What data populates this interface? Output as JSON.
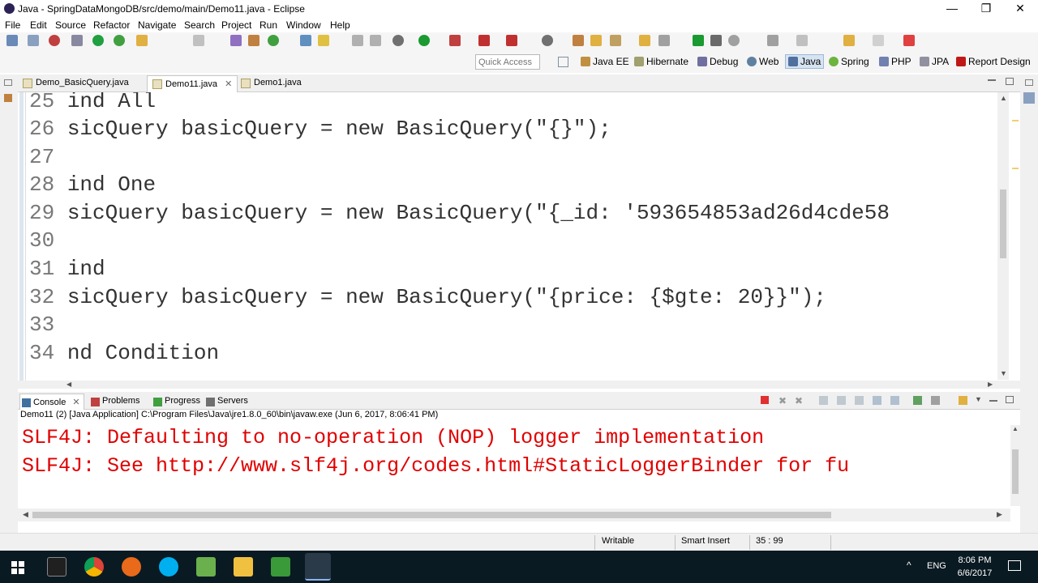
{
  "window": {
    "title": "Java - SpringDataMongoDB/src/demo/main/Demo11.java - Eclipse"
  },
  "menu": [
    "File",
    "Edit",
    "Source",
    "Refactor",
    "Navigate",
    "Search",
    "Project",
    "Run",
    "Window",
    "Help"
  ],
  "quick_access": {
    "placeholder": "Quick Access"
  },
  "perspectives": [
    "Java EE",
    "Hibernate",
    "Debug",
    "Web",
    "Java",
    "Spring",
    "PHP",
    "JPA",
    "Report Design"
  ],
  "editor_tabs": [
    {
      "label": "Demo_BasicQuery.java"
    },
    {
      "label": "Demo11.java"
    },
    {
      "label": "Demo1.java"
    }
  ],
  "code": [
    {
      "num": "25",
      "text": "ind All"
    },
    {
      "num": "26",
      "text": "sicQuery basicQuery = new BasicQuery(\"{}\");"
    },
    {
      "num": "27",
      "text": ""
    },
    {
      "num": "28",
      "text": "ind One"
    },
    {
      "num": "29",
      "text": "sicQuery basicQuery = new BasicQuery(\"{_id: '593654853ad26d4cde58"
    },
    {
      "num": "30",
      "text": ""
    },
    {
      "num": "31",
      "text": "ind"
    },
    {
      "num": "32",
      "text": "sicQuery basicQuery = new BasicQuery(\"{price: {$gte: 20}}\");"
    },
    {
      "num": "33",
      "text": ""
    },
    {
      "num": "34",
      "text": "nd Condition"
    }
  ],
  "console_tabs": [
    "Console",
    "Problems",
    "Progress",
    "Servers"
  ],
  "console_desc": "Demo11 (2) [Java Application] C:\\Program Files\\Java\\jre1.8.0_60\\bin\\javaw.exe (Jun 6, 2017, 8:06:41 PM)",
  "console_lines": [
    "SLF4J: Defaulting to no-operation (NOP) logger implementation",
    "SLF4J: See http://www.slf4j.org/codes.html#StaticLoggerBinder for fu"
  ],
  "status": {
    "writable": "Writable",
    "insert_mode": "Smart Insert",
    "position": "35 : 99"
  },
  "taskbar": {
    "lang": "ENG",
    "time": "8:06 PM",
    "date": "6/6/2017"
  }
}
